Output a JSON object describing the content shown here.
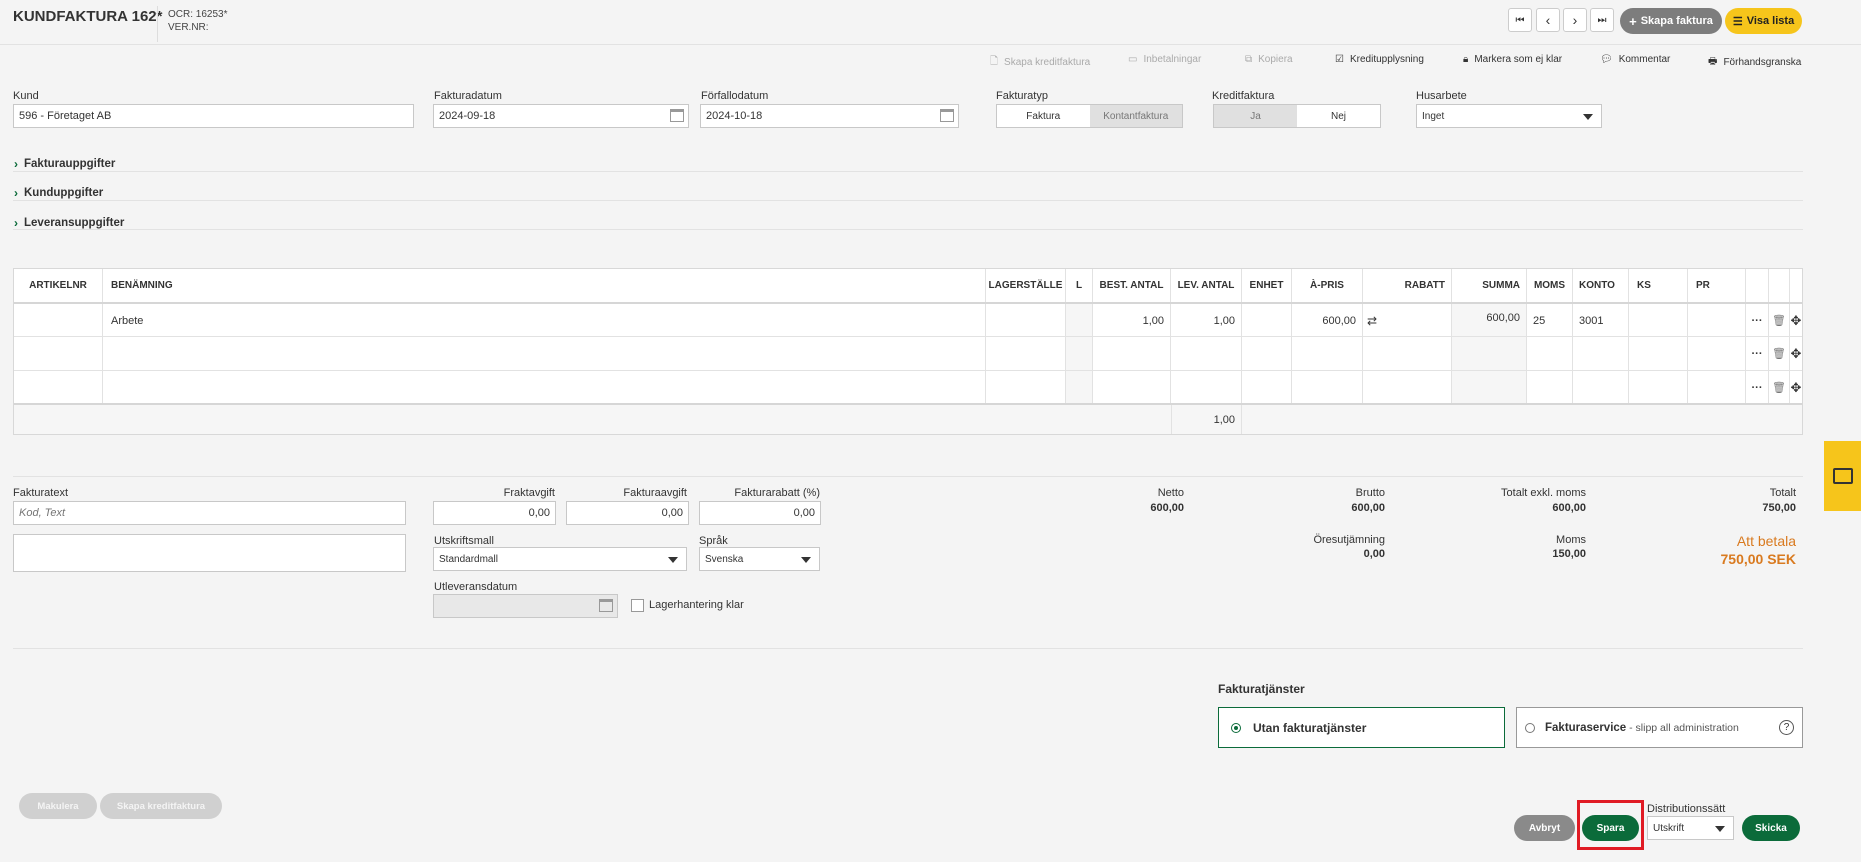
{
  "header": {
    "title": "KUNDFAKTURA 162*",
    "ocr": "OCR: 16253*",
    "ver_nr": "VER.NR:",
    "nav": {
      "first": "⏮",
      "prev": "‹",
      "next": "›",
      "last": "⏭"
    },
    "create_invoice": "Skapa faktura",
    "show_list": "Visa lista"
  },
  "toolbar": {
    "create_credit": "Skapa kreditfaktura",
    "payments": "Inbetalningar",
    "copy": "Kopiera",
    "credit_check": "Kreditupplysning",
    "mark_unready": "Markera som ej klar",
    "comment": "Kommentar",
    "preview": "Förhandsgranska"
  },
  "form": {
    "customer_label": "Kund",
    "customer_value": "596 - Företaget AB",
    "invoice_date_label": "Fakturadatum",
    "invoice_date_value": "2024-09-18",
    "due_date_label": "Förfallodatum",
    "due_date_value": "2024-10-18",
    "invoice_type_label": "Fakturatyp",
    "invoice_type_options": [
      "Faktura",
      "Kontantfaktura"
    ],
    "credit_invoice_label": "Kreditfaktura",
    "credit_options": [
      "Ja",
      "Nej"
    ],
    "house_work_label": "Husarbete",
    "house_work_value": "Inget"
  },
  "sections": [
    "Fakturauppgifter",
    "Kunduppgifter",
    "Leveransuppgifter"
  ],
  "table": {
    "columns": [
      "ARTIKELNR",
      "BENÄMNING",
      "LAGERSTÄLLE",
      "L",
      "BEST. ANTAL",
      "LEV. ANTAL",
      "ENHET",
      "À-PRIS",
      "RABATT",
      "SUMMA",
      "MOMS",
      "KONTO",
      "KS",
      "PR"
    ],
    "row1": {
      "article": "",
      "name": "Arbete",
      "best_antal": "1,00",
      "lev_antal": "1,00",
      "a_pris": "600,00",
      "summa": "600,00",
      "moms": "25",
      "konto": "3001"
    },
    "sum_lev_antal": "1,00"
  },
  "footer": {
    "invoice_text_label": "Fakturatext",
    "invoice_text_placeholder": "Kod, Text",
    "freight_label": "Fraktavgift",
    "freight_value": "0,00",
    "invoice_fee_label": "Fakturaavgift",
    "invoice_fee_value": "0,00",
    "invoice_discount_label": "Fakturarabatt (%)",
    "invoice_discount_value": "0,00",
    "print_template_label": "Utskriftsmall",
    "print_template_value": "Standardmall",
    "language_label": "Språk",
    "language_value": "Svenska",
    "delivery_date_label": "Utleveransdatum",
    "stock_ready_label": "Lagerhantering klar"
  },
  "totals": {
    "netto_label": "Netto",
    "netto_value": "600,00",
    "brutto_label": "Brutto",
    "brutto_value": "600,00",
    "excl_label": "Totalt exkl. moms",
    "excl_value": "600,00",
    "total_label": "Totalt",
    "total_value": "750,00",
    "rounding_label": "Öresutjämning",
    "rounding_value": "0,00",
    "vat_label": "Moms",
    "vat_value": "150,00",
    "to_pay_label": "Att betala",
    "to_pay_value": "750,00 SEK"
  },
  "services": {
    "title": "Fakturatjänster",
    "option1": "Utan fakturatjänster",
    "option2_bold": "Fakturaservice",
    "option2_rest": " - slipp all administration"
  },
  "actions": {
    "cancel_invoice": "Makulera",
    "create_credit": "Skapa kreditfaktura",
    "abort": "Avbryt",
    "save": "Spara",
    "distribution_label": "Distributionssätt",
    "distribution_value": "Utskrift",
    "send": "Skicka"
  },
  "colors": {
    "accent_green": "#0b6b3a",
    "yellow": "#f6c51b",
    "orange": "#d97a1f",
    "highlight_red": "#e01b24"
  }
}
